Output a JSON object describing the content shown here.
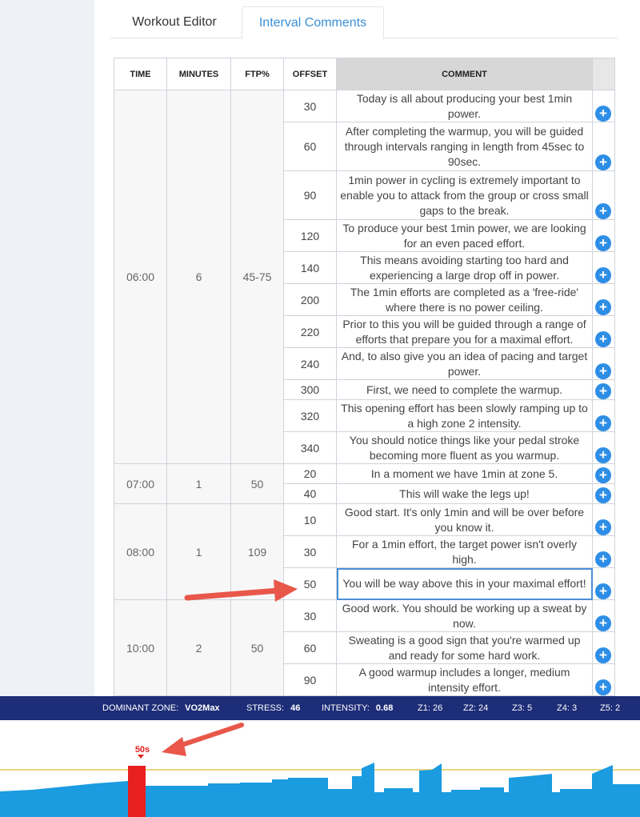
{
  "tabs": [
    {
      "label": "Workout Editor",
      "active": false
    },
    {
      "label": "Interval Comments",
      "active": true
    }
  ],
  "table": {
    "columns": [
      "TIME",
      "MINUTES",
      "FTP%",
      "OFFSET",
      "COMMENT"
    ],
    "groups": [
      {
        "time": "06:00",
        "minutes": "6",
        "ftp": "45-75",
        "rows": [
          {
            "offset": "30",
            "comment": "Today is all about producing your best 1min power."
          },
          {
            "offset": "60",
            "comment": "After completing the warmup, you will be guided through intervals ranging in length from 45sec to 90sec."
          },
          {
            "offset": "90",
            "comment": "1min power in cycling is extremely important to enable you to attack from the group or cross small gaps to the break."
          },
          {
            "offset": "120",
            "comment": "To produce your best 1min power, we are looking for an even paced effort."
          },
          {
            "offset": "140",
            "comment": "This means avoiding starting too hard and experiencing a large drop off in power."
          },
          {
            "offset": "200",
            "comment": "The 1min efforts are completed as a 'free-ride' where there is no power ceiling."
          },
          {
            "offset": "220",
            "comment": "Prior to this you will be guided through a range of efforts that prepare you for a maximal effort."
          },
          {
            "offset": "240",
            "comment": "And, to also give you an idea of pacing and target power."
          },
          {
            "offset": "300",
            "comment": "First, we need to complete the warmup."
          },
          {
            "offset": "320",
            "comment": "This opening effort has been slowly ramping up to a high zone 2 intensity."
          },
          {
            "offset": "340",
            "comment": "You should notice things like your pedal stroke becoming more fluent as you warmup."
          }
        ]
      },
      {
        "time": "07:00",
        "minutes": "1",
        "ftp": "50",
        "rows": [
          {
            "offset": "20",
            "comment": "In a moment we have 1min at zone 5."
          },
          {
            "offset": "40",
            "comment": "This will wake the legs up!"
          }
        ]
      },
      {
        "time": "08:00",
        "minutes": "1",
        "ftp": "109",
        "rows": [
          {
            "offset": "10",
            "comment": "Good start. It's only 1min and will be over before you know it."
          },
          {
            "offset": "30",
            "comment": "For a 1min effort, the target power isn't overly high."
          },
          {
            "offset": "50",
            "comment": "You will be way above this in your maximal effort!",
            "selected": true
          }
        ]
      },
      {
        "time": "10:00",
        "minutes": "2",
        "ftp": "50",
        "rows": [
          {
            "offset": "30",
            "comment": "Good work. You should be working up a sweat by now."
          },
          {
            "offset": "60",
            "comment": "Sweating is a good sign that you're warmed up and ready for some hard work."
          },
          {
            "offset": "90",
            "comment": "A good warmup includes a longer, medium intensity effort."
          }
        ]
      }
    ]
  },
  "stats": {
    "dominant_zone_label": "DOMINANT ZONE:",
    "dominant_zone_value": "VO2Max",
    "stress_label": "STRESS:",
    "stress_value": "46",
    "intensity_label": "INTENSITY:",
    "intensity_value": "0.68",
    "z1": "Z1: 26",
    "z2": "Z2: 24",
    "z3": "Z3: 5",
    "z4": "Z4: 3",
    "z5": "Z5: 2"
  },
  "timeline": {
    "marker_label": "50s",
    "bar_color": "#1b9be0",
    "marker_color": "#e82020",
    "ftp_line_color": "#e6c65a"
  },
  "colors": {
    "accent": "#3a8fd6",
    "add_button": "#2e8ee6",
    "stats_bar": "#1d2d78",
    "annotation_arrow": "#e8574a"
  }
}
